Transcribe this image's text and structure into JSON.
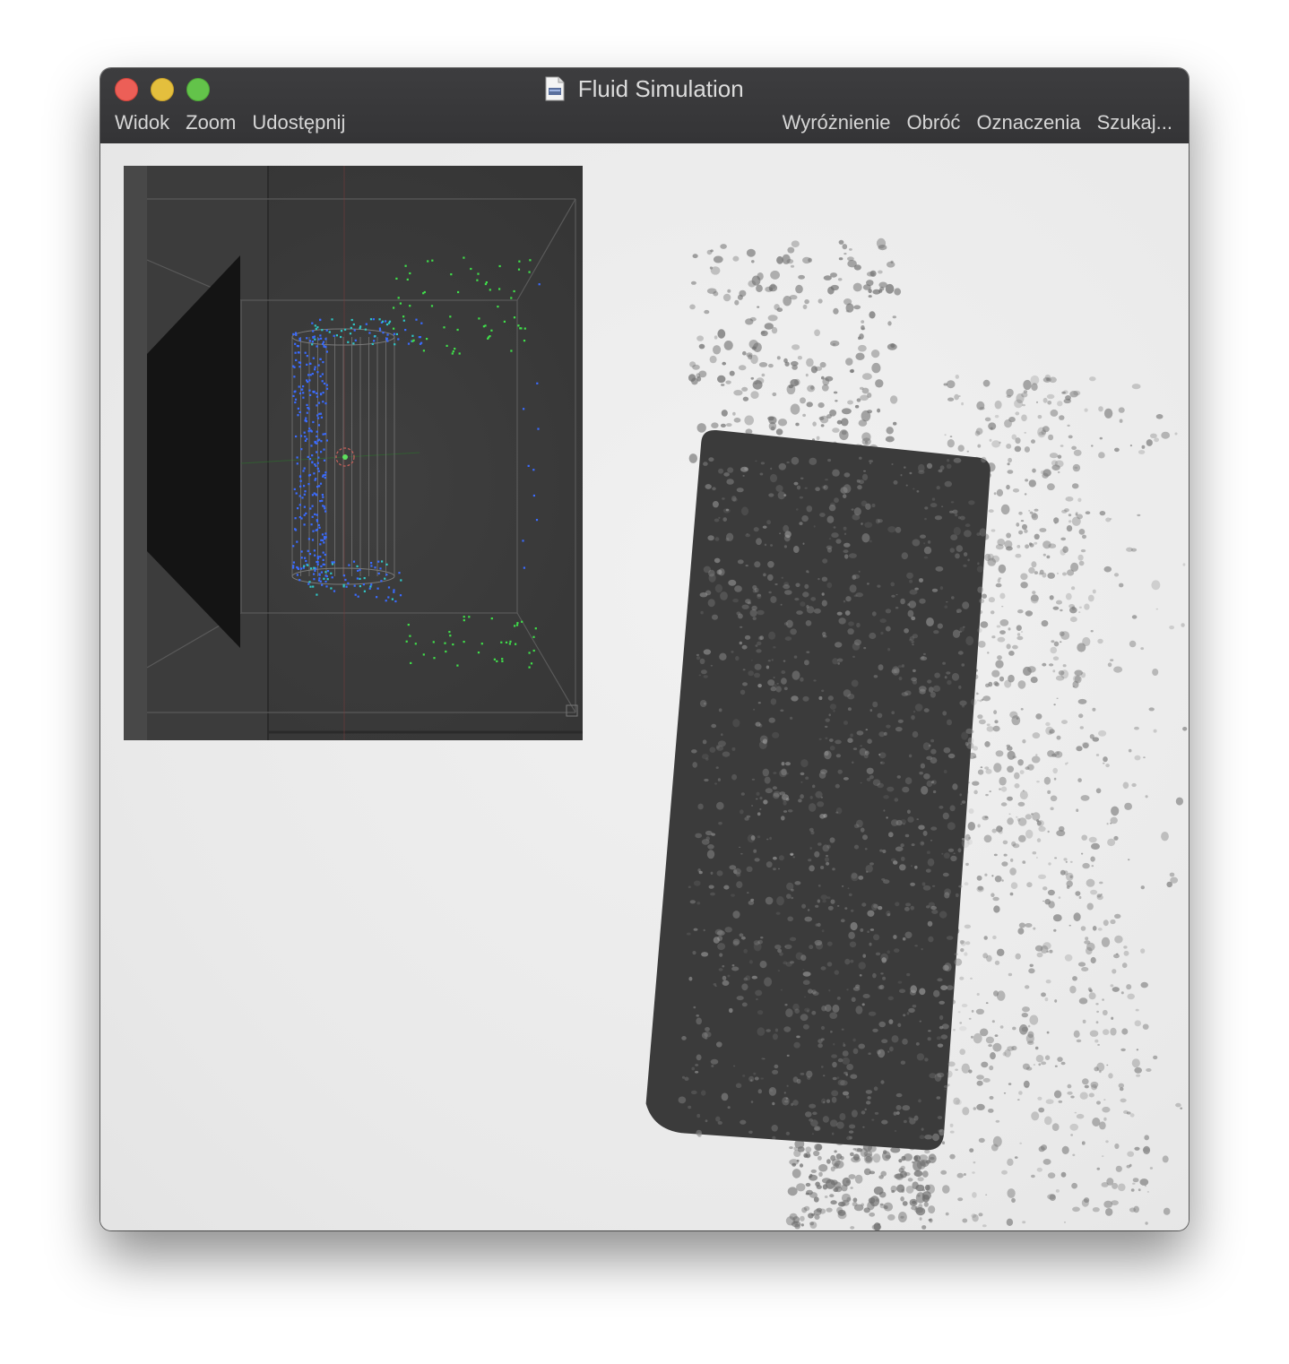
{
  "window": {
    "title": "Fluid Simulation",
    "doc_icon": "document-icon"
  },
  "toolbar": {
    "left": [
      "Widok",
      "Zoom",
      "Udostępnij"
    ],
    "right": [
      "Wyróżnienie",
      "Obróć",
      "Oznaczenia",
      "Szukaj..."
    ]
  },
  "colors": {
    "titlebar": "#3a3a3c",
    "close": "#ec5f57",
    "minimize": "#e4bf3d",
    "maximize": "#63c34a",
    "viewport_bg": "#3a3a3a",
    "particle_blue": "#3a6bff",
    "particle_cyan": "#2fc6c6",
    "particle_green": "#3fe04a",
    "fluid_dark": "#3c3c3c"
  },
  "content": {
    "viewport_icon": "viewport-3d-icon",
    "render_icon": "fluid-render-image"
  }
}
